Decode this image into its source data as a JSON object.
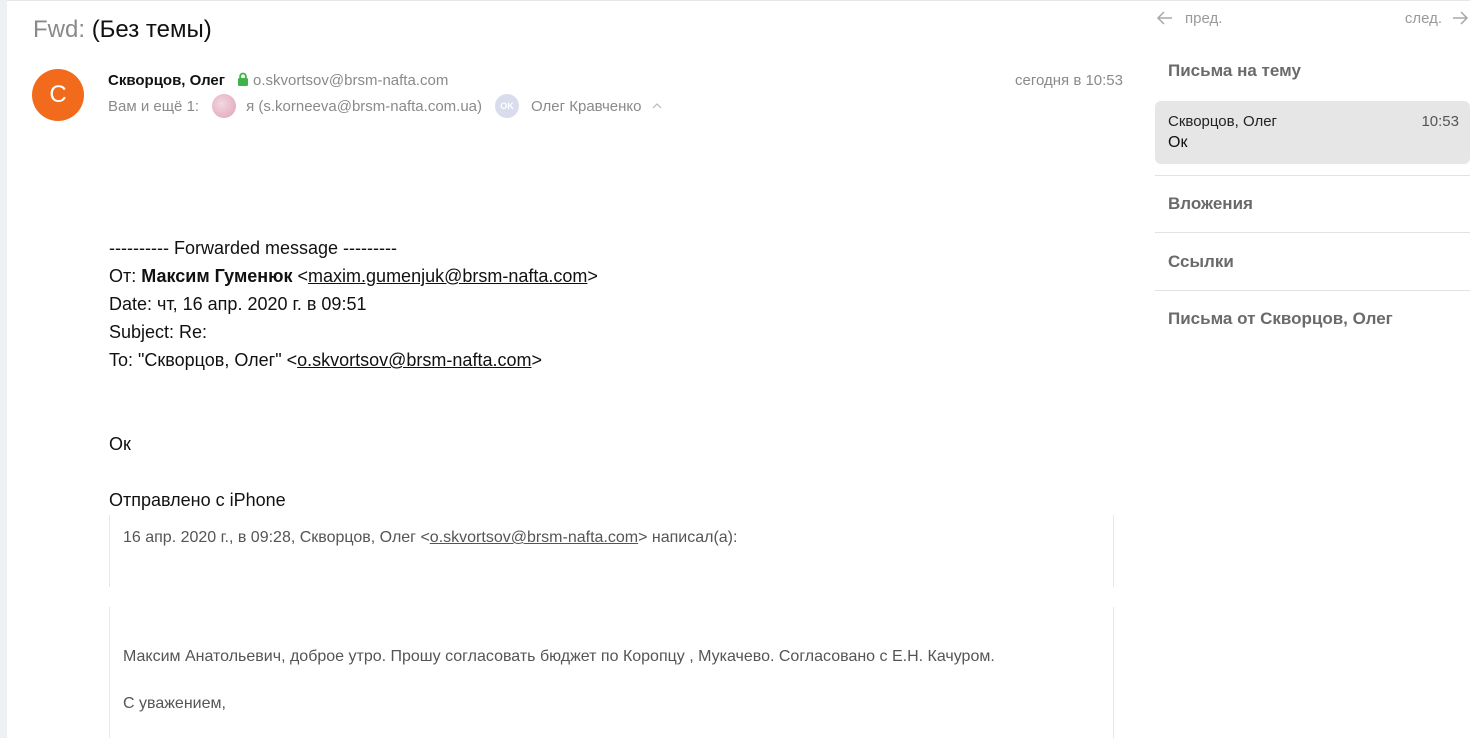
{
  "subject": {
    "prefix": "Fwd:",
    "title": "(Без темы)"
  },
  "header": {
    "avatar_letter": "С",
    "sender_name": "Скворцов, Олег",
    "sender_email": "o.skvortsov@brsm-nafta.com",
    "date": "сегодня в 10:53",
    "recipients_label": "Вам и ещё 1:",
    "recipient_me": "я (s.korneeva@brsm-nafta.com.ua)",
    "recipient_other_initials": "OK",
    "recipient_other": "Олег Кравченко"
  },
  "body": {
    "forward_sep": "---------- Forwarded message ---------",
    "from_label": "От:",
    "from_name": "Максим Гуменюк",
    "from_email": "maxim.gumenjuk@brsm-nafta.com",
    "date_line": "Date: чт, 16 апр. 2020 г. в 09:51",
    "subject_line": "Subject: Re:",
    "to_prefix": "To: \"Скворцов, Олег\" <",
    "to_email": "o.skvortsov@brsm-nafta.com",
    "reply": "Ок",
    "sent_from": "Отправлено с iPhone",
    "quote_header_prefix": "16 апр. 2020 г., в 09:28, Скворцов, Олег <",
    "quote_header_email": "o.skvortsov@brsm-nafta.com",
    "quote_header_suffix": "> написал(а):",
    "quote_text": "Максим Анатольевич, доброе утро. Прошу согласовать бюджет по Коропцу , Мукачево. Согласовано с Е.Н. Качуром.",
    "quote_sign": "С уважением,"
  },
  "sidebar": {
    "prev_label": "пред.",
    "next_label": "след.",
    "thread_title": "Письма на тему",
    "thread_items": [
      {
        "from": "Скворцов, Олег",
        "time": "10:53",
        "snippet": "Ок"
      }
    ],
    "attachments_title": "Вложения",
    "links_title": "Ссылки",
    "from_sender_title": "Письма от Скворцов, Олег"
  },
  "colors": {
    "avatar": "#f26a1b",
    "lock": "#3db34a",
    "muted": "#8a8a8a",
    "selected": "#e6e6e6"
  }
}
